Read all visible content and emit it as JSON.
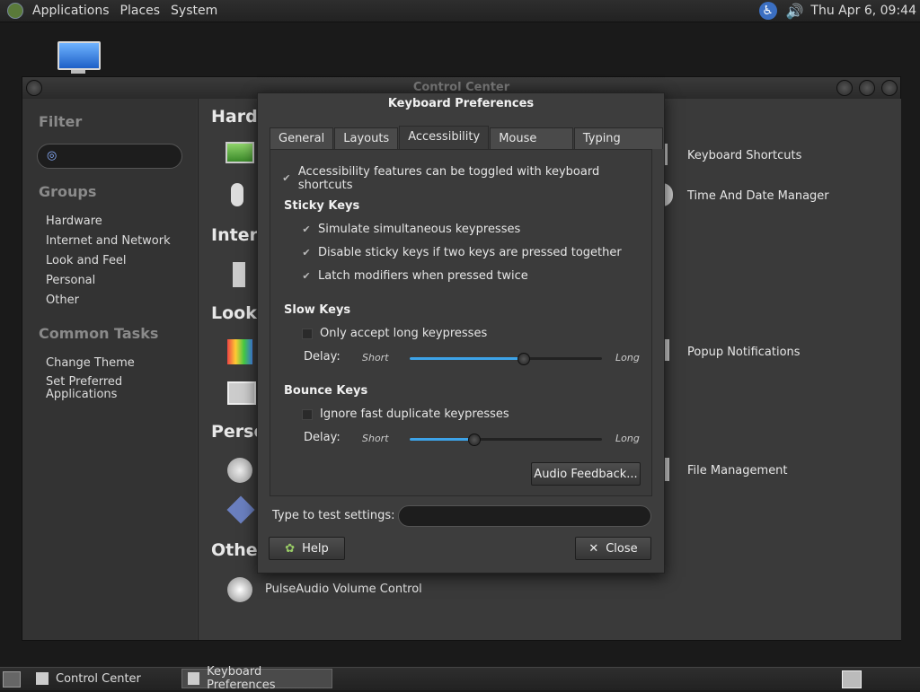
{
  "top_panel": {
    "menus": [
      "Applications",
      "Places",
      "System"
    ],
    "clock": "Thu Apr  6, 09:44",
    "accessibility_glyph": "♿",
    "volume_glyph": "🔊"
  },
  "control_center": {
    "title": "Control Center",
    "sidebar": {
      "filter_heading": "Filter",
      "groups_heading": "Groups",
      "groups": [
        "Hardware",
        "Internet and Network",
        "Look and Feel",
        "Personal",
        "Other"
      ],
      "tasks_heading": "Common Tasks",
      "tasks": [
        "Change Theme",
        "Set Preferred Applications"
      ]
    },
    "sections": {
      "hardware": "Hardw",
      "internet": "Intern",
      "look": "Look",
      "personal": "Perso",
      "other": "Other"
    },
    "items": {
      "keyboard_shortcuts": "Keyboard Shortcuts",
      "time_date": "Time And Date Manager",
      "popup_notifications": "Popup Notifications",
      "file_management": "File Management",
      "pulseaudio": "PulseAudio Volume Control"
    }
  },
  "keyboard_preferences": {
    "title": "Keyboard Preferences",
    "tabs": [
      "General",
      "Layouts",
      "Accessibility",
      "Mouse Keys",
      "Typing Break"
    ],
    "active_tab": "Accessibility",
    "toggle_shortcuts_label": "Accessibility features can be toggled with keyboard shortcuts",
    "sticky_keys": {
      "title": "Sticky Keys",
      "simulate": "Simulate simultaneous keypresses",
      "disable_two": "Disable sticky keys if two keys are pressed together",
      "latch": "Latch modifiers when pressed twice"
    },
    "slow_keys": {
      "title": "Slow Keys",
      "only_long": "Only accept long keypresses",
      "delay_label": "Delay:",
      "short": "Short",
      "long": "Long",
      "delay_fraction": 0.59
    },
    "bounce_keys": {
      "title": "Bounce Keys",
      "ignore_fast": "Ignore fast duplicate keypresses",
      "delay_label": "Delay:",
      "short": "Short",
      "long": "Long",
      "delay_fraction": 0.33
    },
    "audio_feedback_button": "Audio Feedback...",
    "test_label": "Type to test settings:",
    "test_value": "",
    "help_button": "Help",
    "close_button": "Close",
    "checked_glyph": "✔",
    "help_glyph": "✿",
    "close_glyph": "✕"
  },
  "bottom_panel": {
    "tasks": [
      "Control Center",
      "Keyboard Preferences"
    ],
    "active_task": "Keyboard Preferences"
  },
  "colors": {
    "slider_fill": "#3da3e8",
    "accessibility_icon": "#3b6fc2"
  }
}
